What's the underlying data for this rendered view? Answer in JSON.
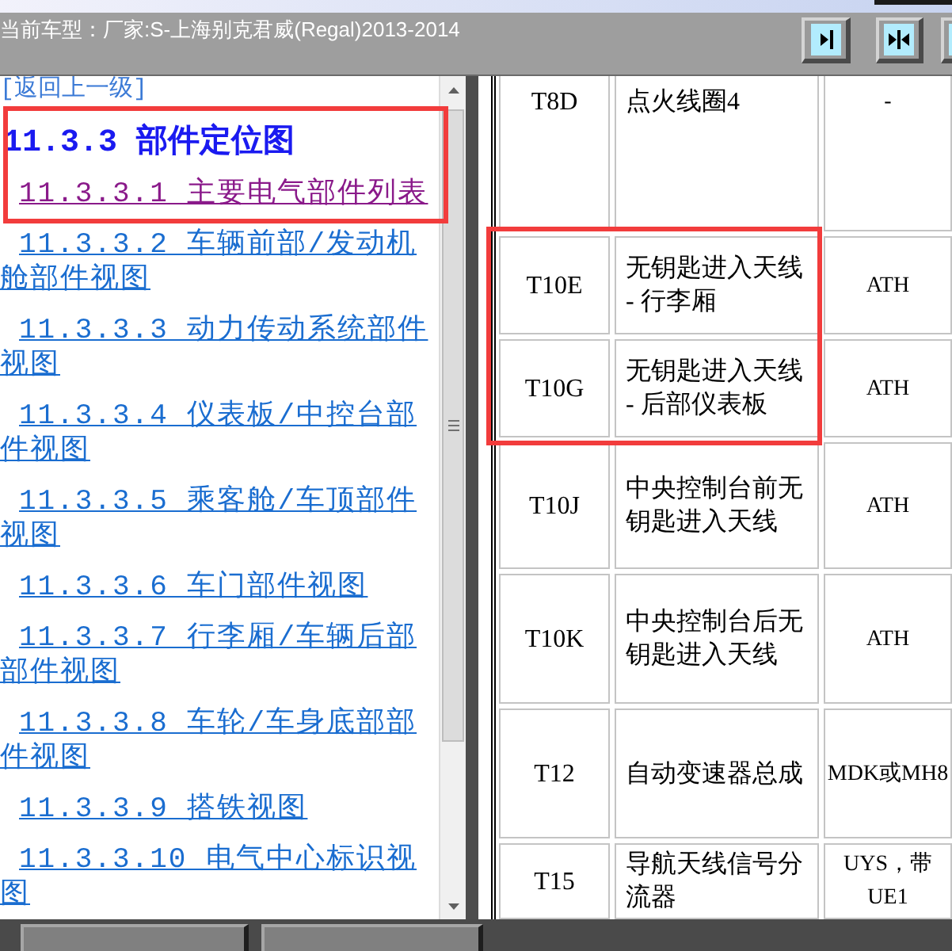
{
  "vehicle_bar": {
    "label": "当前车型：厂家:S-上海别克君威(Regal)2013-2014"
  },
  "nav": {
    "entries": [
      {
        "kind": "back",
        "label": "[返回上一级]",
        "highlighted": false
      },
      {
        "kind": "heading",
        "label": "11.3.3 部件定位图",
        "highlighted": true
      },
      {
        "kind": "link",
        "label": "11.3.3.1 主要电气部件列表",
        "visited": true,
        "highlighted": true
      },
      {
        "kind": "link",
        "label": "11.3.3.2 车辆前部/发动机舱部件视图",
        "visited": false,
        "highlighted": false
      },
      {
        "kind": "link",
        "label": "11.3.3.3 动力传动系统部件视图",
        "visited": false,
        "highlighted": false
      },
      {
        "kind": "link",
        "label": "11.3.3.4 仪表板/中控台部件视图",
        "visited": false,
        "highlighted": false
      },
      {
        "kind": "link",
        "label": "11.3.3.5 乘客舱/车顶部件视图",
        "visited": false,
        "highlighted": false
      },
      {
        "kind": "link",
        "label": "11.3.3.6 车门部件视图",
        "visited": false,
        "highlighted": false
      },
      {
        "kind": "link",
        "label": "11.3.3.7 行李厢/车辆后部部件视图",
        "visited": false,
        "highlighted": false
      },
      {
        "kind": "link",
        "label": "11.3.3.8 车轮/车身底部部件视图",
        "visited": false,
        "highlighted": false
      },
      {
        "kind": "link",
        "label": "11.3.3.9 搭铁视图",
        "visited": false,
        "highlighted": false
      },
      {
        "kind": "link",
        "label": "11.3.3.10 电气中心标识视图",
        "visited": false,
        "highlighted": false
      }
    ]
  },
  "table": {
    "rows": [
      {
        "cells": [
          "T8D",
          "点火线圈4",
          "-"
        ],
        "highlighted": false
      },
      {
        "cells": [
          "T10E",
          "无钥匙进入天线 - 行李厢",
          "ATH"
        ],
        "highlighted": true
      },
      {
        "cells": [
          "T10G",
          "无钥匙进入天线 - 后部仪表板",
          "ATH"
        ],
        "highlighted": true
      },
      {
        "cells": [
          "T10J",
          "中央控制台前无钥匙进入天线",
          "ATH"
        ],
        "highlighted": false
      },
      {
        "cells": [
          "T10K",
          "中央控制台后无钥匙进入天线",
          "ATH"
        ],
        "highlighted": false
      },
      {
        "cells": [
          "T12",
          "自动变速器总成",
          "MDK或MH8"
        ],
        "highlighted": false
      },
      {
        "cells": [
          "T15",
          "导航天线信号分流器",
          "UYS，带UE1"
        ],
        "highlighted": false
      }
    ]
  }
}
